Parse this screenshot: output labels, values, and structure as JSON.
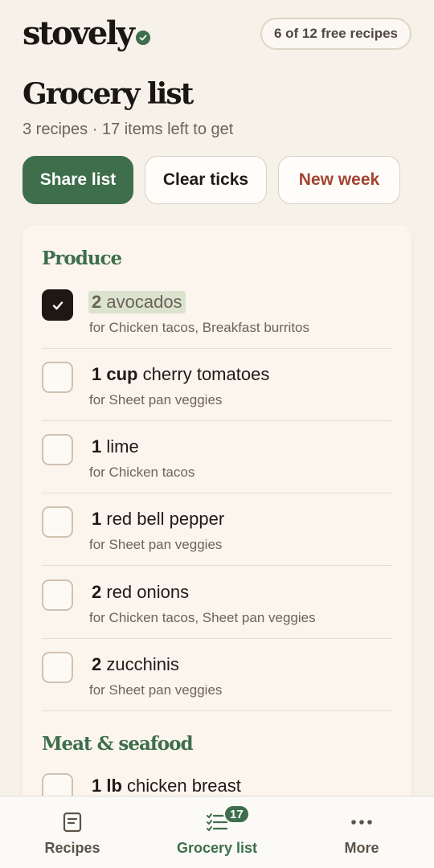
{
  "app": {
    "logo_text": "stovely",
    "free_recipes_pill": "6 of 12 free recipes"
  },
  "page": {
    "title": "Grocery list",
    "subtitle": "3 recipes · 17 items left to get"
  },
  "actions": {
    "share_label": "Share list",
    "clear_label": "Clear ticks",
    "new_week_label": "New week"
  },
  "colors": {
    "accent_green": "#3e6e4c",
    "danger_red": "#a3442f",
    "background": "#f6f1e9"
  },
  "sections": [
    {
      "title": "Produce",
      "items": [
        {
          "qty": "2",
          "name": "avocados",
          "for": "for Chicken tacos, Breakfast burritos",
          "checked": true
        },
        {
          "qty": "1 cup",
          "name": "cherry tomatoes",
          "for": "for Sheet pan veggies",
          "checked": false
        },
        {
          "qty": "1",
          "name": "lime",
          "for": "for Chicken tacos",
          "checked": false
        },
        {
          "qty": "1",
          "name": "red bell pepper",
          "for": "for Sheet pan veggies",
          "checked": false
        },
        {
          "qty": "2",
          "name": "red onions",
          "for": "for Chicken tacos, Sheet pan veggies",
          "checked": false
        },
        {
          "qty": "2",
          "name": "zucchinis",
          "for": "for Sheet pan veggies",
          "checked": false
        }
      ]
    },
    {
      "title": "Meat & seafood",
      "items": [
        {
          "qty": "1 lb",
          "name": "chicken breast",
          "checked": false
        }
      ]
    }
  ],
  "nav": {
    "recipes_label": "Recipes",
    "grocery_label": "Grocery list",
    "grocery_badge": "17",
    "more_label": "More",
    "icons": [
      "recipe-book-icon",
      "checklist-icon",
      "more-dots-icon"
    ]
  }
}
